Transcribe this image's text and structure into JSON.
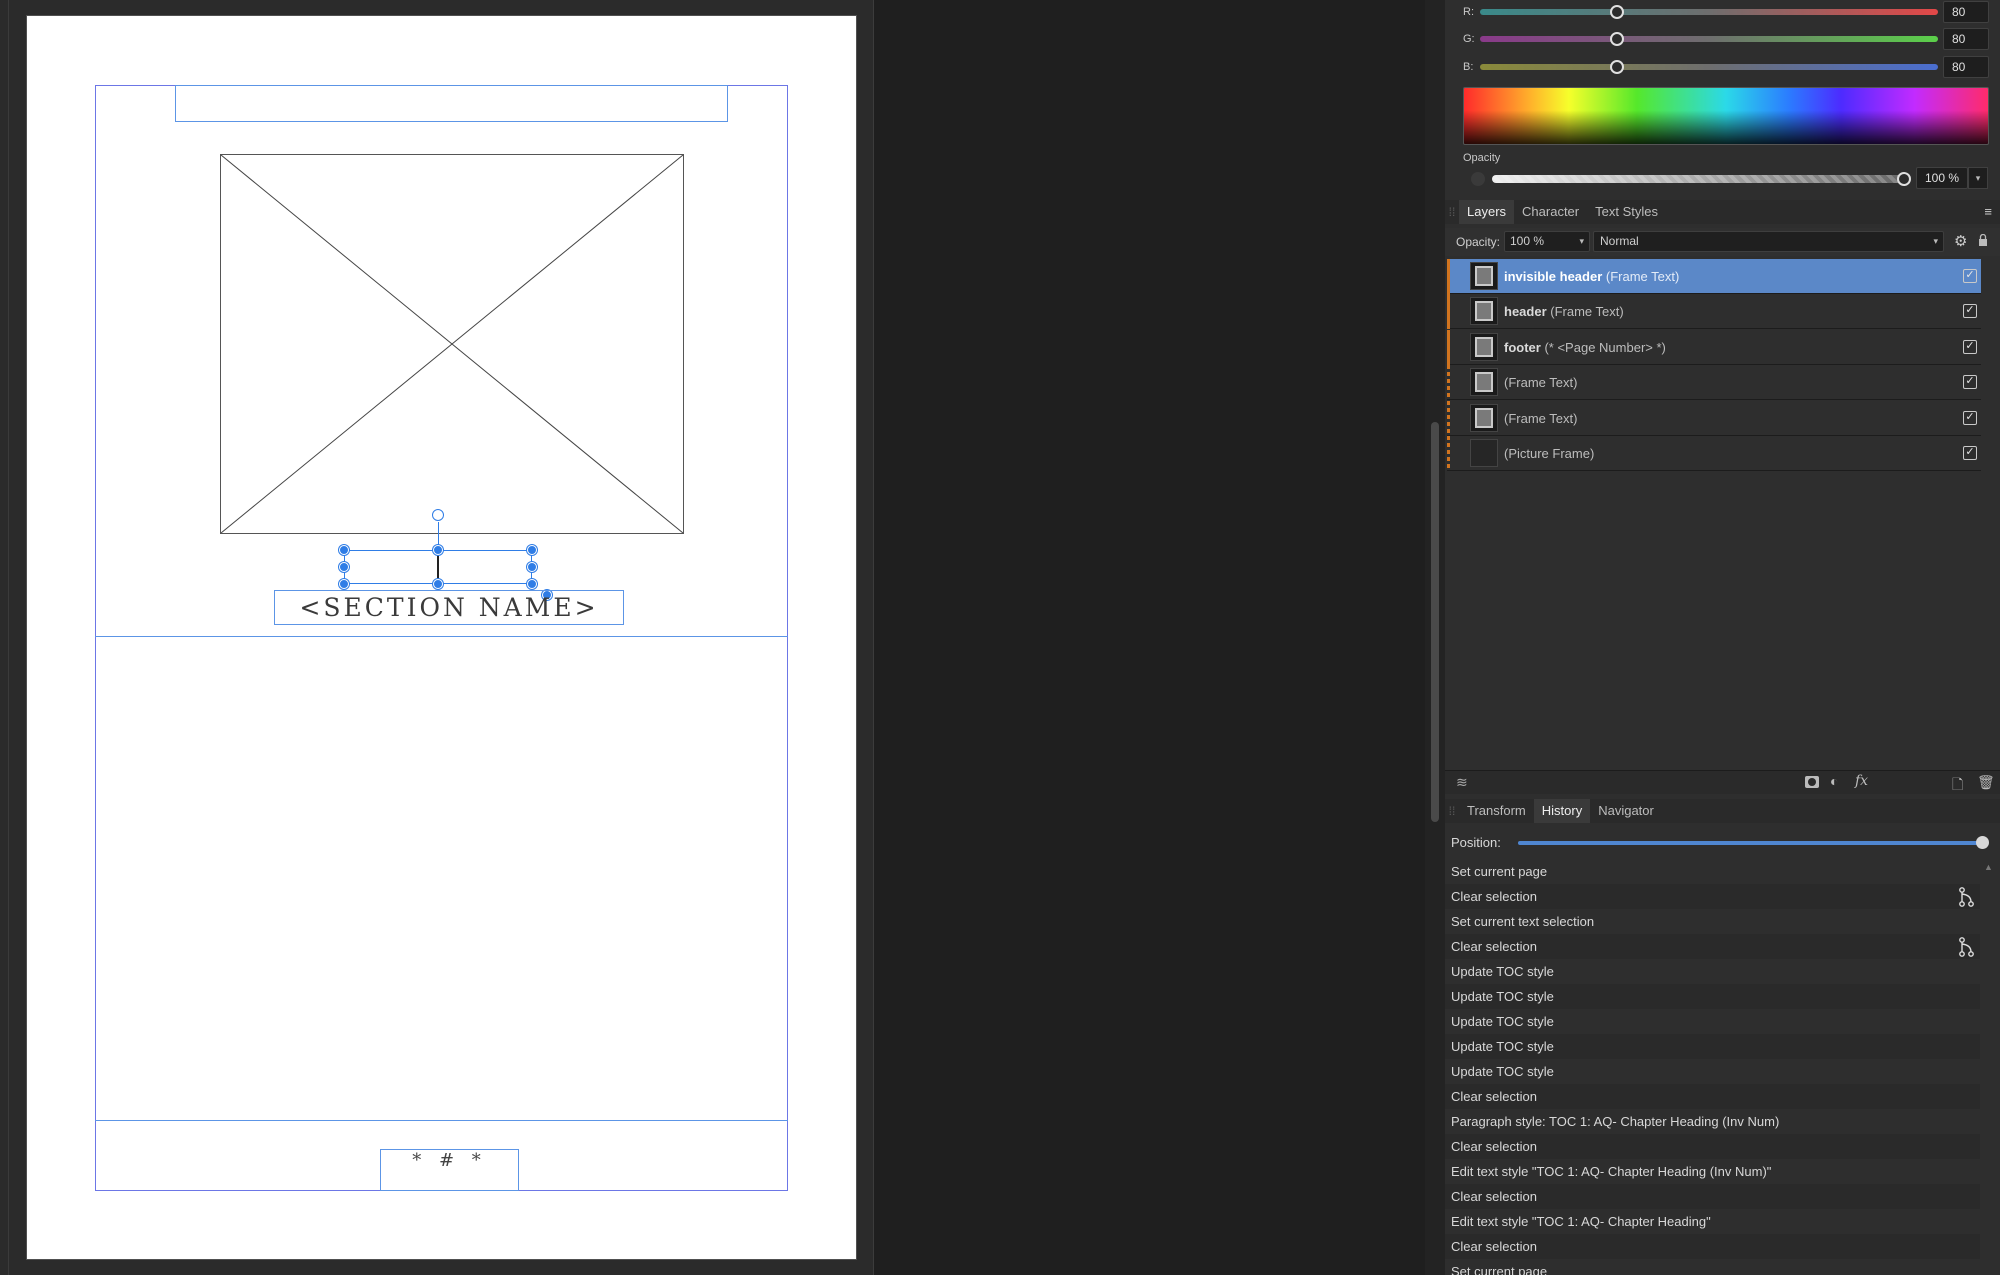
{
  "canvas": {
    "section_name": "<SECTION NAME>",
    "footer_marker": "* # *"
  },
  "color_panel": {
    "r_label": "R:",
    "g_label": "G:",
    "b_label": "B:",
    "r_value": "80",
    "g_value": "80",
    "b_value": "80",
    "r_level": 0.3,
    "g_level": 0.3,
    "b_level": 0.3,
    "opacity_label": "Opacity",
    "opacity_value": "100 %"
  },
  "layers_panel": {
    "tabs": [
      "Layers",
      "Character",
      "Text Styles"
    ],
    "opacity_label": "Opacity:",
    "opacity_value": "100 %",
    "blend_mode": "Normal",
    "layers": [
      {
        "name": "invisible header",
        "type": "(Frame Text)"
      },
      {
        "name": "header",
        "type": "(Frame Text)"
      },
      {
        "name": "footer",
        "type": "(* <Page Number> *)"
      },
      {
        "name": "",
        "type": "(Frame Text)"
      },
      {
        "name": "",
        "type": "(Frame Text)"
      },
      {
        "name": "",
        "type": "(Picture Frame)"
      }
    ]
  },
  "history_panel": {
    "tabs": [
      "Transform",
      "History",
      "Navigator"
    ],
    "position_label": "Position:",
    "items": [
      "Set current page",
      "Clear selection",
      "Set current text selection",
      "Clear selection",
      "Update TOC style",
      "Update TOC style",
      "Update TOC style",
      "Update TOC style",
      "Update TOC style",
      "Clear selection",
      "Paragraph style: TOC 1: AQ- Chapter Heading (Inv Num)",
      "Clear selection",
      "Edit text style \"TOC 1: AQ- Chapter Heading (Inv Num)\"",
      "Clear selection",
      "Edit text style \"TOC 1: AQ- Chapter Heading\"",
      "Clear selection",
      "Set current page"
    ]
  },
  "colors": {
    "selection_blue": "#5b88c8",
    "frame_blue": "#5c95e6",
    "layer_orange": "#d1741f"
  }
}
